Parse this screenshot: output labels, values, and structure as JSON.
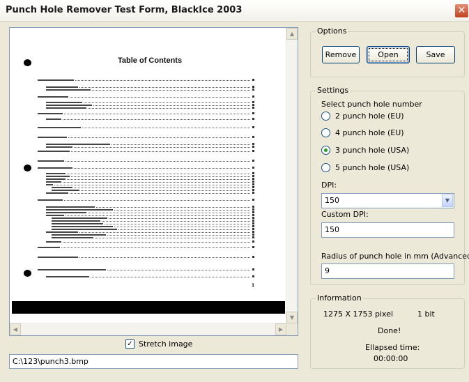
{
  "window": {
    "title": "Punch Hole Remover Test Form, BlackIce 2003",
    "close_glyph": "✕"
  },
  "document_preview": {
    "page_title": "Table of Contents",
    "page_number": "1"
  },
  "stretch_image": {
    "label": "Stretch image",
    "checked": true,
    "check_glyph": "✓"
  },
  "file_path": "C:\\123\\punch3.bmp",
  "options": {
    "legend": "Options",
    "remove_label": "Remove",
    "open_label": "Open",
    "save_label": "Save"
  },
  "settings": {
    "legend": "Settings",
    "select_label": "Select punch hole number",
    "radios": [
      {
        "label": "2 punch hole (EU)",
        "selected": false
      },
      {
        "label": "4 punch hole (EU)",
        "selected": false
      },
      {
        "label": "3 punch hole (USA)",
        "selected": true
      },
      {
        "label": "5 punch hole (USA)",
        "selected": false
      }
    ],
    "dpi_label": "DPI:",
    "dpi_value": "150",
    "custom_dpi_label": "Custom DPI:",
    "custom_dpi_value": "150",
    "radius_label": "Radius of punch hole in mm (Advanced)",
    "radius_value": "9"
  },
  "information": {
    "legend": "Information",
    "dimensions": "1275 X 1753 pixel",
    "bit_depth": "1 bit",
    "status": "Done!",
    "elapsed_label": "Ellapsed time:",
    "elapsed_value": "00:00:00"
  },
  "scroll_glyphs": {
    "up": "▲",
    "down": "▼",
    "left": "◀",
    "right": "▶"
  },
  "colors": {
    "radio_selected": "#21a121",
    "close_button": "#c1411f",
    "title_bar": "#ffffff"
  }
}
